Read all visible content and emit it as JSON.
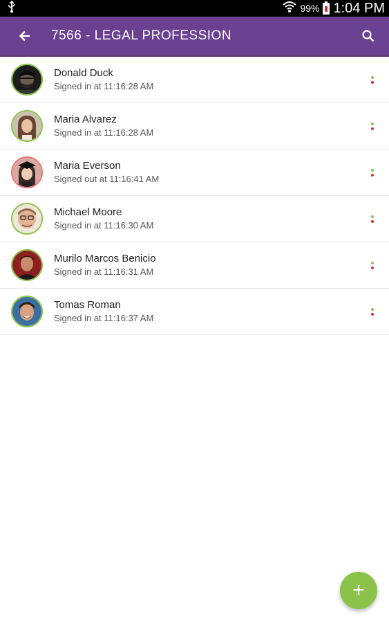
{
  "status_bar": {
    "battery_percent": "99%",
    "time": "1:04 PM",
    "icons": [
      "usb-icon",
      "wifi-icon",
      "battery-icon"
    ]
  },
  "app_bar": {
    "title": "7566 - LEGAL PROFESSION",
    "back_icon": "arrow-left-icon",
    "search_icon": "search-icon"
  },
  "attendees": [
    {
      "name": "Donald Duck",
      "status": "Signed in at 11:16:28 AM",
      "state": "in"
    },
    {
      "name": "Maria Alvarez",
      "status": "Signed in at 11:16:28 AM",
      "state": "in"
    },
    {
      "name": "Maria Everson",
      "status": "Signed out at 11:16:41 AM",
      "state": "out"
    },
    {
      "name": "Michael Moore",
      "status": "Signed in at 11:16:30 AM",
      "state": "in"
    },
    {
      "name": "Murilo Marcos Benicio",
      "status": "Signed in at 11:16:31 AM",
      "state": "in"
    },
    {
      "name": "Tomas Roman",
      "status": "Signed in at 11:16:37 AM",
      "state": "in"
    }
  ],
  "fab": {
    "label": "+",
    "icon": "plus-icon"
  },
  "colors": {
    "app_bar": "#6a4091",
    "signed_in": "#8bc34a",
    "signed_out": "#e57373",
    "fab": "#8bc34a",
    "dot_red": "#d32f2f"
  }
}
